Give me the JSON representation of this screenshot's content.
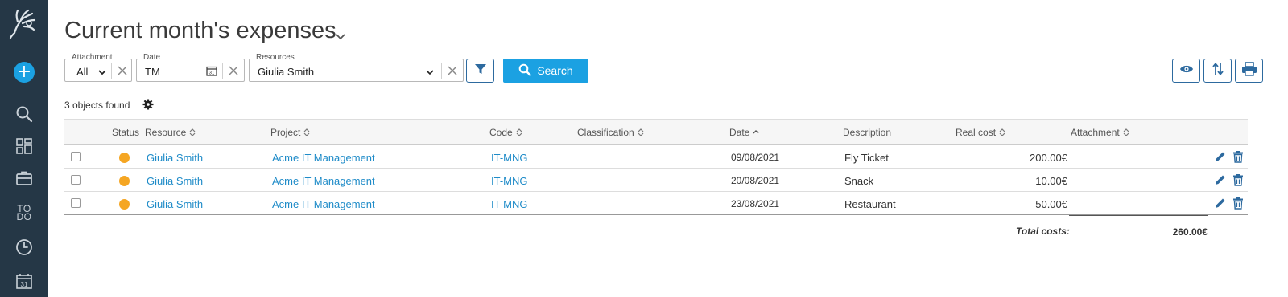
{
  "sidebar": {
    "todo_label": "TO DO",
    "items": [
      "logo-icon",
      "add-icon",
      "search-icon",
      "dashboard-icon",
      "briefcase-icon",
      "todo-icon",
      "clock-icon",
      "calendar-icon"
    ]
  },
  "page": {
    "title": "Current month's expenses"
  },
  "filters": {
    "attachment": {
      "label": "Attachment",
      "value": "All"
    },
    "date": {
      "label": "Date",
      "value": "TM"
    },
    "resources": {
      "label": "Resources",
      "value": "Giulia Smith"
    }
  },
  "search_button": {
    "label": "Search"
  },
  "results": {
    "count_text": "3 objects found"
  },
  "table": {
    "columns": {
      "status": "Status",
      "resource": "Resource",
      "project": "Project",
      "code": "Code",
      "classification": "Classification",
      "date": "Date",
      "description": "Description",
      "real_cost": "Real cost",
      "attachment": "Attachment"
    },
    "rows": [
      {
        "resource": "Giulia Smith",
        "project": "Acme IT Management",
        "code": "IT-MNG",
        "classification": "",
        "date": "09/08/2021",
        "description": "Fly Ticket",
        "real_cost": "200.00€",
        "attachment": ""
      },
      {
        "resource": "Giulia Smith",
        "project": "Acme IT Management",
        "code": "IT-MNG",
        "classification": "",
        "date": "20/08/2021",
        "description": "Snack",
        "real_cost": "10.00€",
        "attachment": ""
      },
      {
        "resource": "Giulia Smith",
        "project": "Acme IT Management",
        "code": "IT-MNG",
        "classification": "",
        "date": "23/08/2021",
        "description": "Restaurant",
        "real_cost": "50.00€",
        "attachment": ""
      }
    ]
  },
  "totals": {
    "label": "Total costs:",
    "value": "260.00€"
  },
  "colors": {
    "sidebar_bg": "#253746",
    "accent": "#1ba1e2",
    "link": "#1e8bc8",
    "status_dot": "#f5a623",
    "button_border": "#2d6a9f"
  }
}
